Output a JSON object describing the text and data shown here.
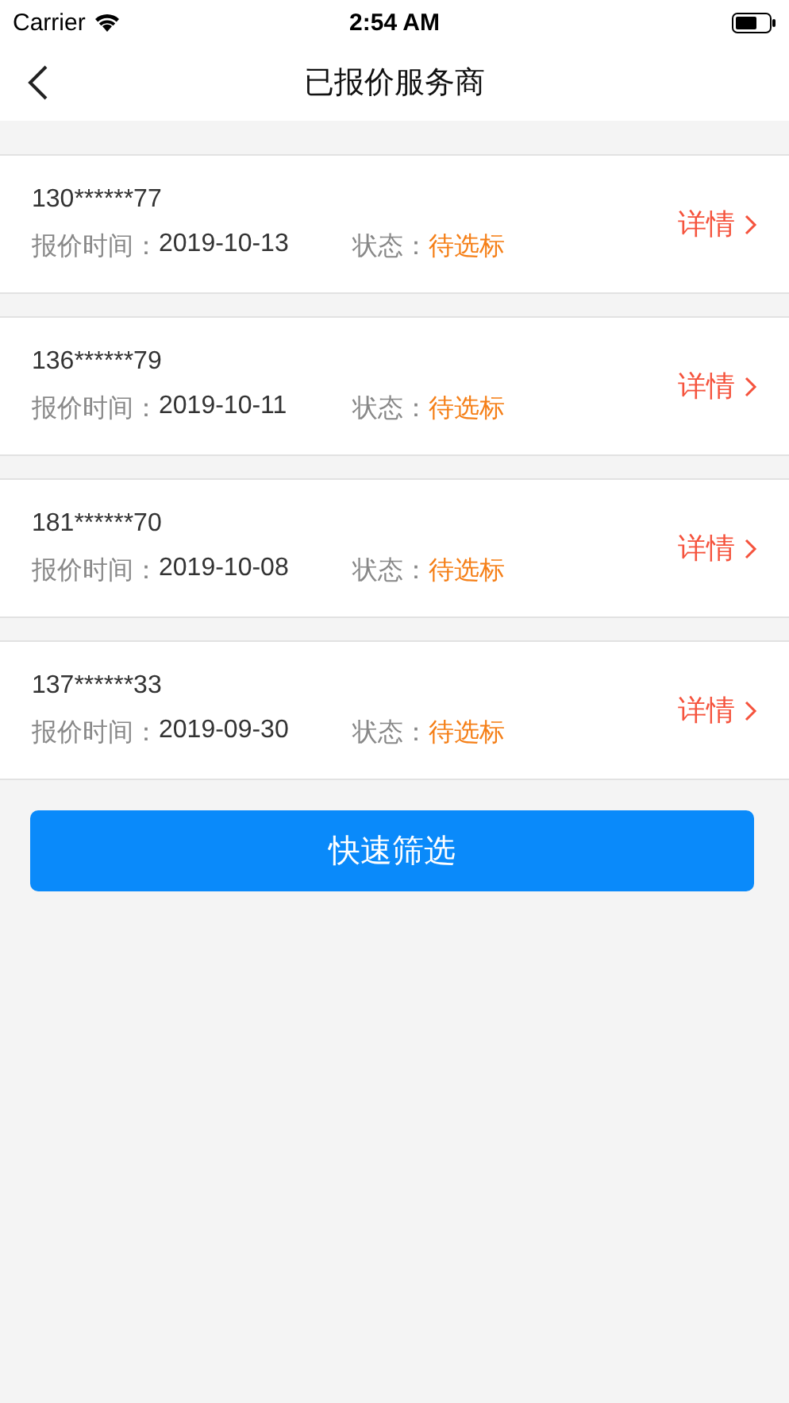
{
  "status_bar": {
    "carrier": "Carrier",
    "time": "2:54 AM"
  },
  "nav": {
    "title": "已报价服务商"
  },
  "quotes": [
    {
      "phone": "130******77",
      "time_label": "报价时间：",
      "time": "2019-10-13",
      "status_label": "状态：",
      "status": "待选标",
      "link": "详情"
    },
    {
      "phone": "136******79",
      "time_label": "报价时间：",
      "time": "2019-10-11",
      "status_label": "状态：",
      "status": "待选标",
      "link": "详情"
    },
    {
      "phone": "181******70",
      "time_label": "报价时间：",
      "time": "2019-10-08",
      "status_label": "状态：",
      "status": "待选标",
      "link": "详情"
    },
    {
      "phone": "137******33",
      "time_label": "报价时间：",
      "time": "2019-09-30",
      "status_label": "状态：",
      "status": "待选标",
      "link": "详情"
    }
  ],
  "filter_button": "快速筛选"
}
